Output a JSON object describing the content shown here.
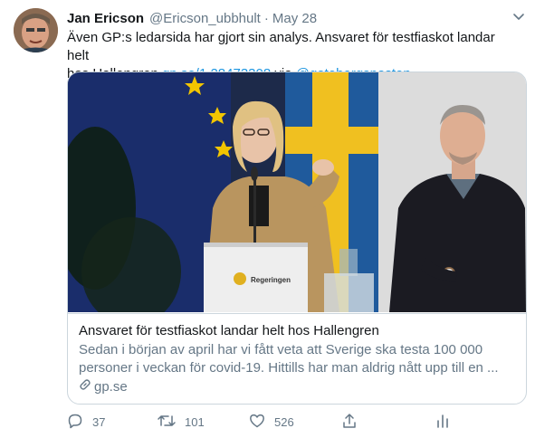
{
  "author": {
    "name": "Jan Ericson",
    "handle": "@Ericson_ubbhult",
    "separator": "·",
    "date": "May 28"
  },
  "tweet": {
    "text_line1": "Även GP:s ledarsida har gjort sin analys. Ansvaret för testfiaskot landar helt",
    "text_line2_prefix": "hos Hallengren ",
    "link": "gp.se/1.28473308",
    "via_word": " via ",
    "via_handle": "@goteborgsposten"
  },
  "card": {
    "podium_sign": "Regeringen",
    "title": "Ansvaret för testfiaskot landar helt hos Hallengren",
    "description_line1": "Sedan i början av april har vi fått veta att Sverige ska testa 100 000",
    "description_line2": "personer i veckan för covid-19. Hittills har man aldrig nått upp till en ...",
    "domain": "gp.se"
  },
  "actions": {
    "reply_count": "37",
    "retweet_count": "101",
    "like_count": "526"
  },
  "colors": {
    "link": "#1b95e0",
    "secondary_text": "#657786",
    "border": "#ccd6dd"
  }
}
